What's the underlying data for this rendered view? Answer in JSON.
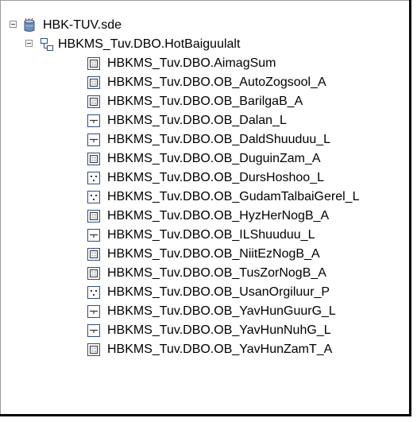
{
  "tree": {
    "root": {
      "label": "HBK-TUV.sde",
      "icon": "database-icon",
      "expanded": true
    },
    "dataset": {
      "label": "HBKMS_Tuv.DBO.HotBaiguulalt",
      "icon": "feature-dataset-icon",
      "expanded": true
    },
    "items": [
      {
        "label": "HBKMS_Tuv.DBO.AimagSum",
        "type": "polygon"
      },
      {
        "label": "HBKMS_Tuv.DBO.OB_AutoZogsool_A",
        "type": "polygon"
      },
      {
        "label": "HBKMS_Tuv.DBO.OB_BarilgaB_A",
        "type": "polygon"
      },
      {
        "label": "HBKMS_Tuv.DBO.OB_Dalan_L",
        "type": "line"
      },
      {
        "label": "HBKMS_Tuv.DBO.OB_DaldShuuduu_L",
        "type": "line"
      },
      {
        "label": "HBKMS_Tuv.DBO.OB_DuguinZam_A",
        "type": "polygon"
      },
      {
        "label": "HBKMS_Tuv.DBO.OB_DursHoshoo_L",
        "type": "point"
      },
      {
        "label": "HBKMS_Tuv.DBO.OB_GudamTalbaiGerel_L",
        "type": "point"
      },
      {
        "label": "HBKMS_Tuv.DBO.OB_HyzHerNogB_A",
        "type": "polygon"
      },
      {
        "label": "HBKMS_Tuv.DBO.OB_ILShuuduu_L",
        "type": "line"
      },
      {
        "label": "HBKMS_Tuv.DBO.OB_NiitEzNogB_A",
        "type": "polygon"
      },
      {
        "label": "HBKMS_Tuv.DBO.OB_TusZorNogB_A",
        "type": "polygon"
      },
      {
        "label": "HBKMS_Tuv.DBO.OB_UsanOrgiluur_P",
        "type": "point"
      },
      {
        "label": "HBKMS_Tuv.DBO.OB_YavHunGuurG_L",
        "type": "line"
      },
      {
        "label": "HBKMS_Tuv.DBO.OB_YavHunNuhG_L",
        "type": "line"
      },
      {
        "label": "HBKMS_Tuv.DBO.OB_YavHunZamT_A",
        "type": "polygon"
      }
    ]
  }
}
